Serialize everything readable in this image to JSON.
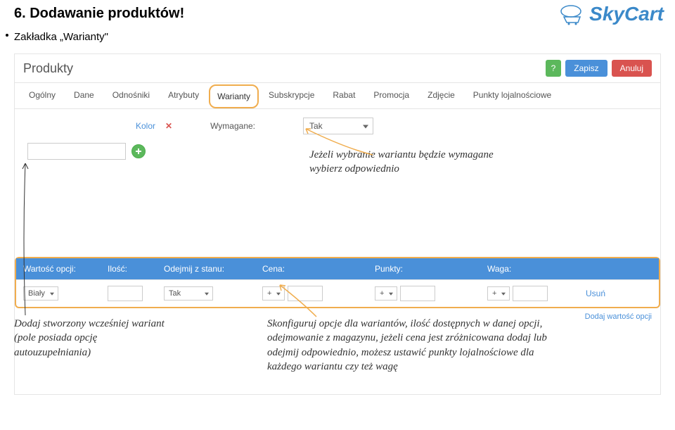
{
  "heading": "6. Dodawanie produktów!",
  "subheading": "Zakładka „Warianty\"",
  "logo": "SkyCart",
  "panel": {
    "title": "Produkty",
    "save": "Zapisz",
    "cancel": "Anuluj",
    "help": "?"
  },
  "tabs": [
    "Ogólny",
    "Dane",
    "Odnośniki",
    "Atrybuty",
    "Warianty",
    "Subskrypcje",
    "Rabat",
    "Promocja",
    "Zdjęcie",
    "Punkty lojalnościowe"
  ],
  "active_tab": "Warianty",
  "variant": {
    "kolor_label": "Kolor",
    "wymagane_label": "Wymagane:",
    "wymagane_value": "Tak"
  },
  "options_header": {
    "name": "Wartość opcji:",
    "qty": "Ilość:",
    "stock": "Odejmij z stanu:",
    "price": "Cena:",
    "points": "Punkty:",
    "weight": "Waga:"
  },
  "options_row": {
    "name": "Biały",
    "stock": "Tak",
    "price_op": "+",
    "points_op": "+",
    "weight_op": "+",
    "delete": "Usuń",
    "add": "Dodaj wartość opcji"
  },
  "annotations": {
    "a1": "Jeżeli wybranie wariantu będzie wymagane wybierz odpowiednio",
    "a2": "Dodaj stworzony wcześniej wariant (pole posiada opcję autouzupełniania)",
    "a3": "Skonfiguruj opcje dla wariantów, ilość dostępnych w danej opcji, odejmowanie z magazynu, jeżeli cena jest zróżnicowana dodaj lub odejmij odpowiednio, możesz ustawić punkty lojalnościowe dla każdego wariantu czy też wagę"
  }
}
